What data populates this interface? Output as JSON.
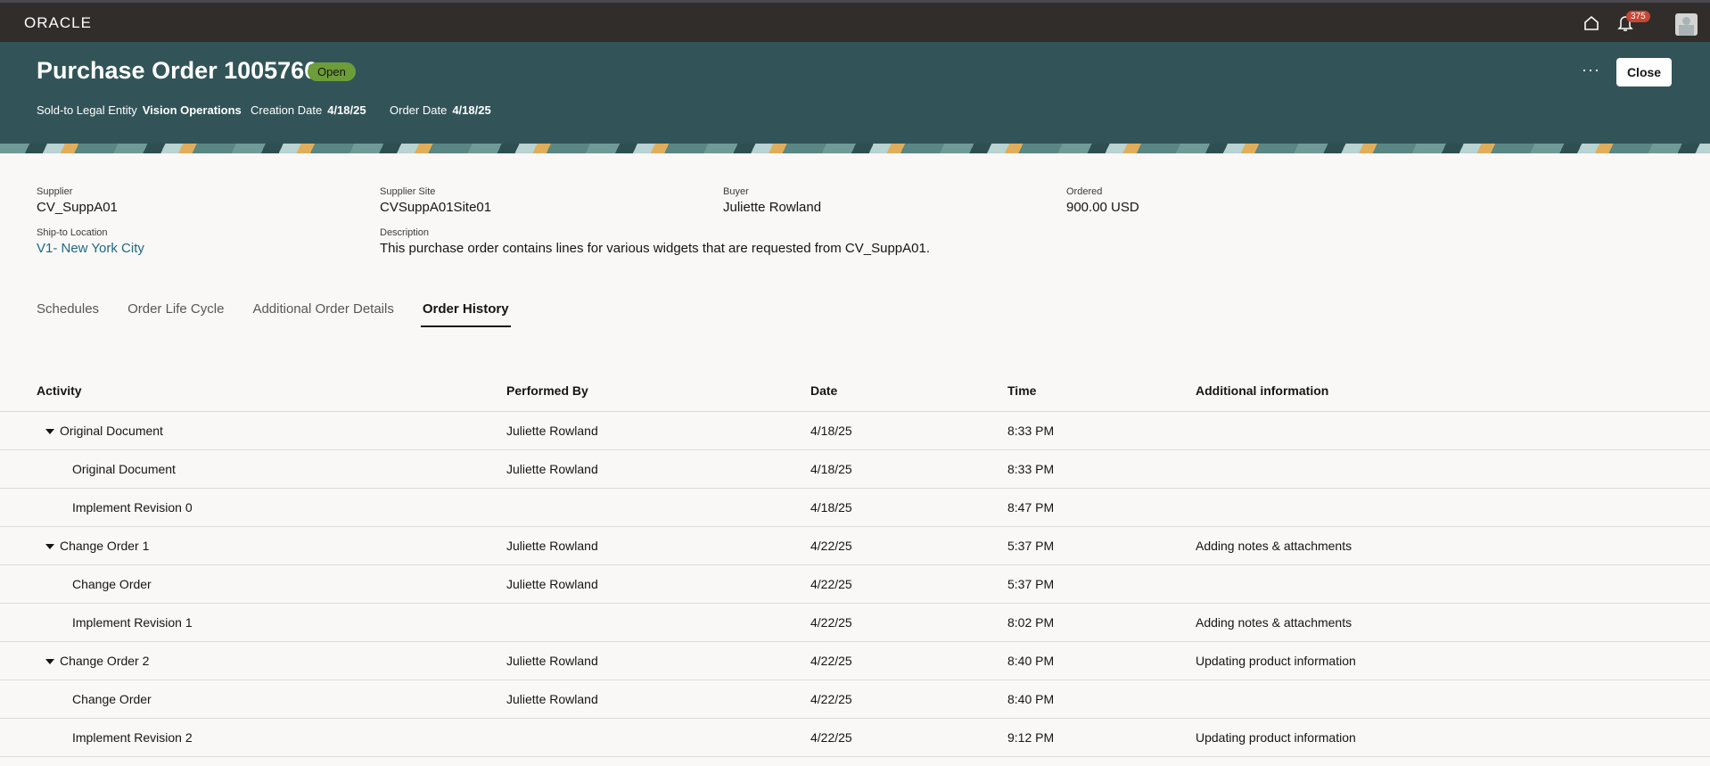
{
  "topbar": {
    "logo": "ORACLE",
    "notification_count": "375"
  },
  "header": {
    "title": "Purchase Order 1005766",
    "status": "Open",
    "close_label": "Close",
    "more_label": "···",
    "meta": [
      {
        "label": "Sold-to Legal Entity",
        "value": "Vision Operations"
      },
      {
        "label": "Creation Date",
        "value": "4/18/25"
      },
      {
        "label": "Order Date",
        "value": "4/18/25"
      }
    ]
  },
  "details": {
    "supplier": {
      "label": "Supplier",
      "value": "CV_SuppA01"
    },
    "supplier_site": {
      "label": "Supplier Site",
      "value": "CVSuppA01Site01"
    },
    "buyer": {
      "label": "Buyer",
      "value": "Juliette Rowland"
    },
    "ordered": {
      "label": "Ordered",
      "value": "900.00 USD"
    },
    "ship_to": {
      "label": "Ship-to Location",
      "value": "V1- New York City"
    },
    "description": {
      "label": "Description",
      "value": "This purchase order contains lines for various widgets that are requested from CV_SuppA01."
    }
  },
  "tabs": [
    {
      "label": "Schedules"
    },
    {
      "label": "Order Life Cycle"
    },
    {
      "label": "Additional Order Details"
    },
    {
      "label": "Order History",
      "active": true
    }
  ],
  "table": {
    "columns": [
      "Activity",
      "Performed By",
      "Date",
      "Time",
      "Additional information"
    ],
    "rows": [
      {
        "activity": "Original Document",
        "by": "Juliette Rowland",
        "date": "4/18/25",
        "time": "8:33 PM",
        "info": "",
        "group": true
      },
      {
        "activity": "Original Document",
        "by": "Juliette Rowland",
        "date": "4/18/25",
        "time": "8:33 PM",
        "info": ""
      },
      {
        "activity": "Implement Revision 0",
        "by": "",
        "date": "4/18/25",
        "time": "8:47 PM",
        "info": ""
      },
      {
        "activity": "Change Order 1",
        "by": "Juliette Rowland",
        "date": "4/22/25",
        "time": "5:37 PM",
        "info": "Adding notes & attachments",
        "group": true
      },
      {
        "activity": "Change Order",
        "by": "Juliette Rowland",
        "date": "4/22/25",
        "time": "5:37 PM",
        "info": ""
      },
      {
        "activity": "Implement Revision 1",
        "by": "",
        "date": "4/22/25",
        "time": "8:02 PM",
        "info": "Adding notes & attachments"
      },
      {
        "activity": "Change Order 2",
        "by": "Juliette Rowland",
        "date": "4/22/25",
        "time": "8:40 PM",
        "info": "Updating product information",
        "group": true
      },
      {
        "activity": "Change Order",
        "by": "Juliette Rowland",
        "date": "4/22/25",
        "time": "8:40 PM",
        "info": ""
      },
      {
        "activity": "Implement Revision 2",
        "by": "",
        "date": "4/22/25",
        "time": "9:12 PM",
        "info": "Updating product information"
      }
    ]
  }
}
